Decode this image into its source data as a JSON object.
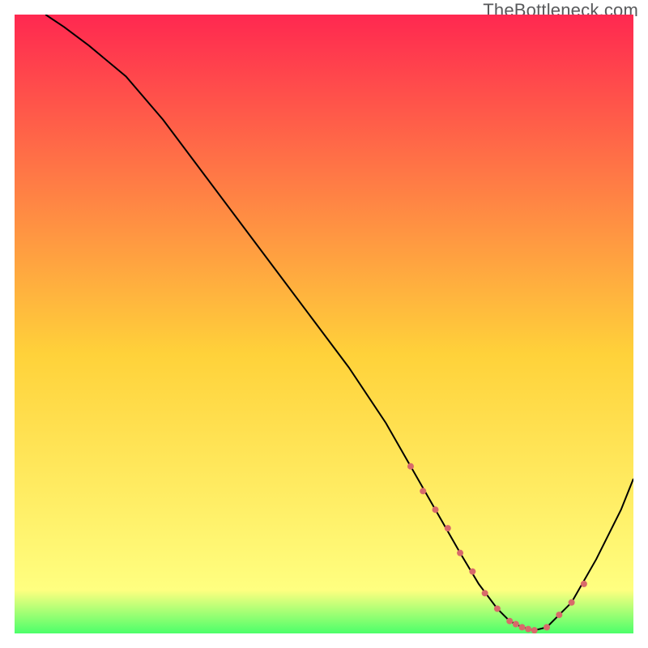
{
  "watermark": "TheBottleneck.com",
  "chart_data": {
    "type": "line",
    "title": "",
    "xlabel": "",
    "ylabel": "",
    "xlim": [
      0,
      100
    ],
    "ylim": [
      0,
      100
    ],
    "grid": false,
    "legend": false,
    "background_gradient": {
      "top": "#ff2850",
      "mid": "#ffd23a",
      "near_bottom": "#ffff80",
      "bottom": "#4cff6a"
    },
    "series": [
      {
        "name": "bottleneck-curve",
        "color": "#000000",
        "stroke_width": 2,
        "x": [
          5,
          8,
          12,
          18,
          24,
          30,
          36,
          42,
          48,
          54,
          60,
          64,
          68,
          72,
          75,
          78,
          80,
          82,
          84,
          86,
          90,
          94,
          98,
          100
        ],
        "y": [
          100,
          98,
          95,
          90,
          83,
          75,
          67,
          59,
          51,
          43,
          34,
          27,
          20,
          13,
          8,
          4,
          2,
          1,
          0.5,
          1,
          5,
          12,
          20,
          25
        ]
      }
    ],
    "markers": {
      "name": "highlight-dots",
      "color": "#d86a6a",
      "radius": 4,
      "x": [
        64,
        66,
        68,
        70,
        72,
        74,
        76,
        78,
        80,
        81,
        82,
        83,
        84,
        86,
        88,
        90,
        92
      ],
      "y": [
        27,
        23,
        20,
        17,
        13,
        10,
        6.5,
        4,
        2,
        1.5,
        1,
        0.7,
        0.5,
        1,
        3,
        5,
        8
      ]
    }
  }
}
